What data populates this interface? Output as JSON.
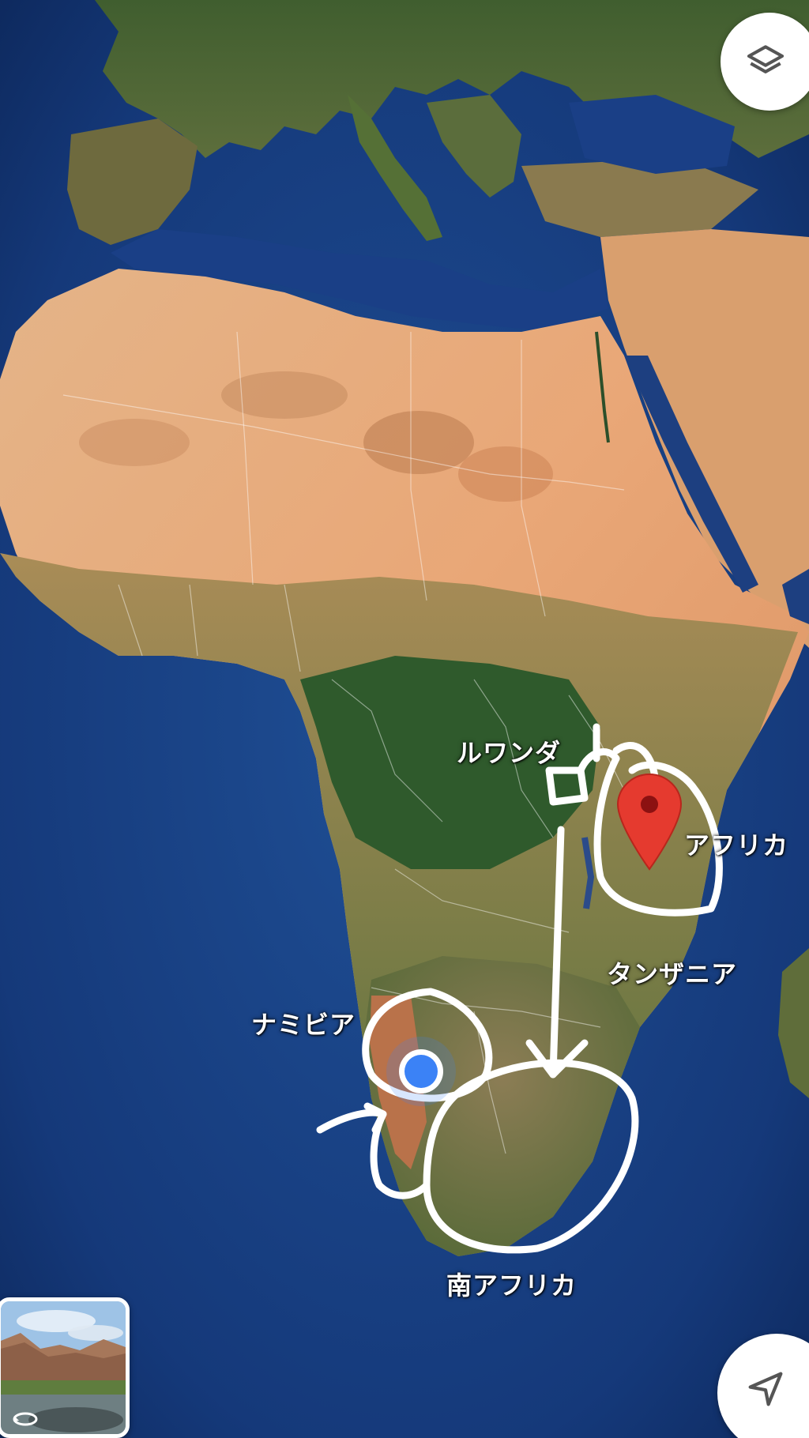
{
  "map": {
    "mode": "satellite",
    "region": "Africa",
    "labels": {
      "rwanda": "ルワンダ",
      "africa": "アフリカ",
      "tanzania": "タンザニア",
      "namibia": "ナミビア",
      "south_africa": "南アフリカ"
    },
    "pin_color": "#e53a2f",
    "location_dot_color": "#3b82f6",
    "annotation_color": "#ffffff"
  },
  "controls": {
    "layers_icon": "layers-icon",
    "locate_icon": "navigation-arrow-icon",
    "streetview_icon": "360-rotate-icon"
  }
}
